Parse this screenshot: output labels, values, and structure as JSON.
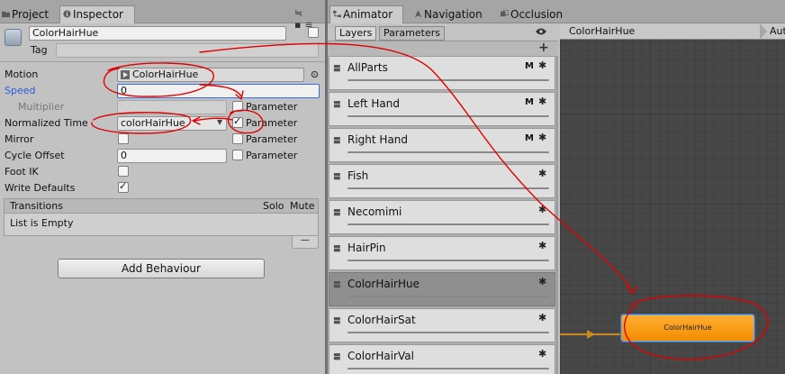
{
  "inspector_window": {
    "tabs": [
      {
        "label": "Project",
        "active": false
      },
      {
        "label": "Inspector",
        "active": true
      }
    ],
    "window_icons": "≒ ▪≡"
  },
  "inspector": {
    "state_name": "ColorHairHue",
    "tag_label": "Tag",
    "tag_value": "",
    "motion": {
      "label": "Motion",
      "value": "ColorHairHue"
    },
    "speed": {
      "label": "Speed",
      "value": "0"
    },
    "multiplier": {
      "label": "Multiplier",
      "param_label": "Parameter",
      "param_checked": false
    },
    "normalized_time": {
      "label": "Normalized Time",
      "value": "colorHairHue",
      "param_label": "Parameter",
      "param_checked": true
    },
    "mirror": {
      "label": "Mirror",
      "checked": false,
      "param_label": "Parameter",
      "param_checked": false
    },
    "cycle_offset": {
      "label": "Cycle Offset",
      "value": "0",
      "param_label": "Parameter",
      "param_checked": false
    },
    "foot_ik": {
      "label": "Foot IK",
      "checked": false
    },
    "write_defaults": {
      "label": "Write Defaults",
      "checked": true
    },
    "transitions": {
      "header": "Transitions",
      "solo": "Solo",
      "mute": "Mute",
      "empty_text": "List is Empty"
    },
    "minus_symbol": "—",
    "add_behaviour": "Add Behaviour"
  },
  "animator_window": {
    "tabs": [
      {
        "label": "Animator",
        "active": true
      },
      {
        "label": "Navigation",
        "active": false
      },
      {
        "label": "Occlusion",
        "active": false
      }
    ],
    "subtabs": {
      "layers": "Layers",
      "parameters": "Parameters"
    },
    "add_symbol": "+",
    "breadcrumb": "ColorHairHue",
    "auto_label": "Aut"
  },
  "layers": [
    {
      "name": "AllParts",
      "badge": "M",
      "selected": false
    },
    {
      "name": "Left Hand",
      "badge": "M",
      "selected": false
    },
    {
      "name": "Right Hand",
      "badge": "M",
      "selected": false
    },
    {
      "name": "Fish",
      "badge": "",
      "selected": false
    },
    {
      "name": "Necomimi",
      "badge": "",
      "selected": false
    },
    {
      "name": "HairPin",
      "badge": "",
      "selected": false
    },
    {
      "name": "ColorHairHue",
      "badge": "",
      "selected": true
    },
    {
      "name": "ColorHairSat",
      "badge": "",
      "selected": false
    },
    {
      "name": "ColorHairVal",
      "badge": "",
      "selected": false
    }
  ],
  "graph": {
    "state_node_label": "ColorHairHue",
    "colors": {
      "node": "#f29300",
      "transition": "#c98a1e",
      "annotation": "#e00000"
    }
  }
}
